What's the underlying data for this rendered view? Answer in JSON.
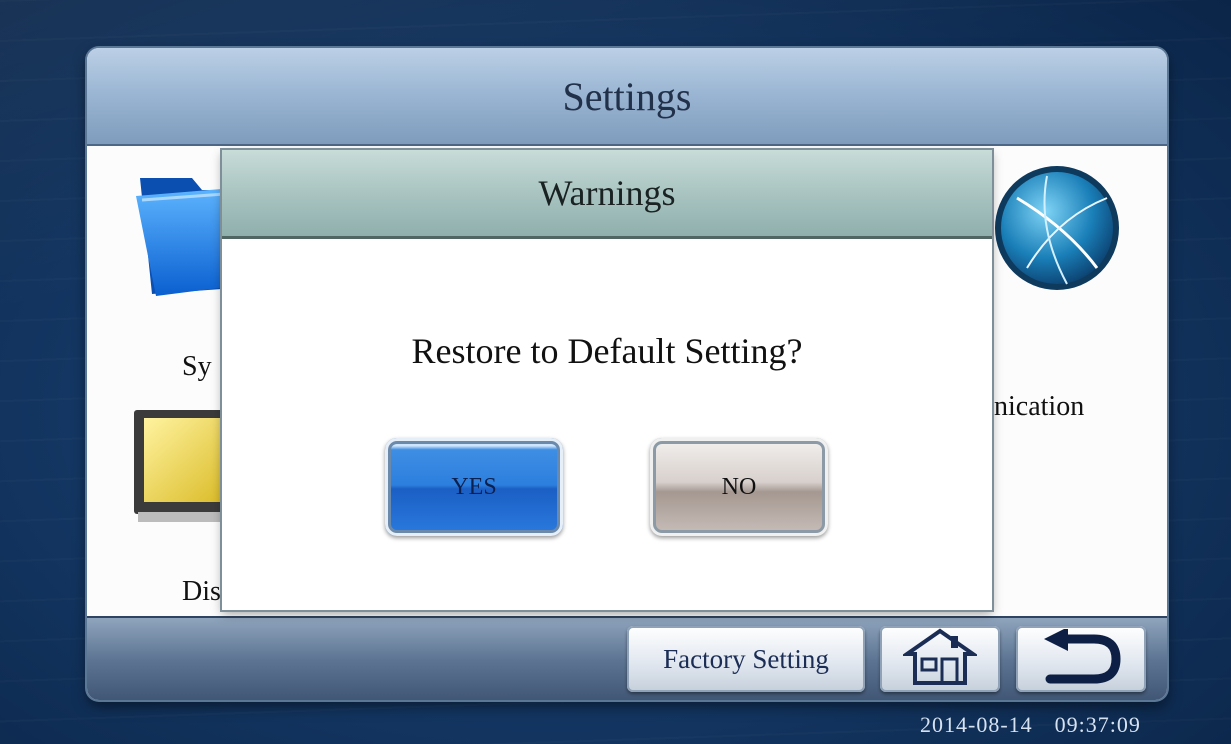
{
  "window": {
    "title": "Settings"
  },
  "items": [
    {
      "label": "Sy",
      "icon": "folder-icon"
    },
    {
      "label": "unication",
      "icon": "globe-icon"
    },
    {
      "label": "Dis",
      "icon": "monitor-icon"
    }
  ],
  "footer": {
    "factory_label": "Factory Setting",
    "home_icon": "home-icon",
    "back_icon": "back-arrow-icon"
  },
  "dialog": {
    "title": "Warnings",
    "message": "Restore to Default Setting?",
    "yes_label": "YES",
    "no_label": "NO"
  },
  "status": {
    "date": "2014-08-14",
    "time": "09:37:09"
  },
  "colors": {
    "yes_button": "#2c7fde",
    "header": "#9cb7d4",
    "dialog_header": "#a9c4c1"
  }
}
